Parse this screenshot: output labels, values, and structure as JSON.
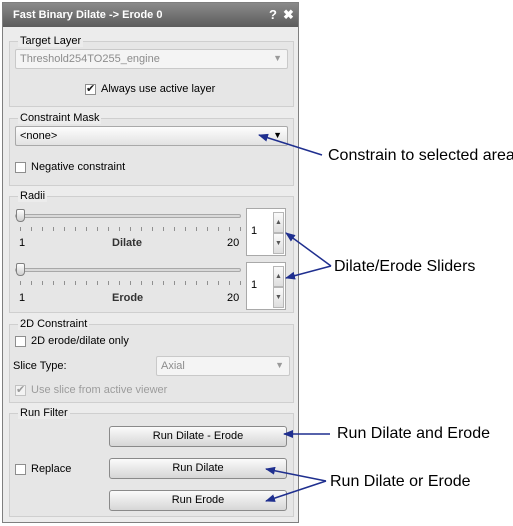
{
  "window": {
    "title": "Fast Binary Dilate -> Erode 0",
    "help_glyph": "?",
    "close_glyph": "✖"
  },
  "target_layer": {
    "group_title": "Target Layer",
    "selected": "Threshold254TO255_engine",
    "always_active_label": "Always use active layer",
    "always_active_checked": true
  },
  "constraint_mask": {
    "group_title": "Constraint Mask",
    "selected": "<none>",
    "negative_label": "Negative constraint",
    "negative_checked": false
  },
  "radii": {
    "group_title": "Radii",
    "sliders": [
      {
        "name": "Dilate",
        "min": "1",
        "max": "20",
        "value": "1"
      },
      {
        "name": "Erode",
        "min": "1",
        "max": "20",
        "value": "1"
      }
    ]
  },
  "constraint_2d": {
    "group_title": "2D Constraint",
    "only_label": "2D erode/dilate only",
    "only_checked": false,
    "slice_type_label": "Slice Type:",
    "slice_type_value": "Axial",
    "use_slice_label": "Use slice from active viewer",
    "use_slice_checked": true
  },
  "run_filter": {
    "group_title": "Run Filter",
    "replace_label": "Replace",
    "replace_checked": false,
    "buttons": [
      "Run Dilate - Erode",
      "Run Dilate",
      "Run Erode"
    ]
  },
  "annotations": {
    "constrain": "Constrain to selected area",
    "sliders": "Dilate/Erode Sliders",
    "run_both": "Run Dilate and Erode",
    "run_either": "Run Dilate or Erode"
  },
  "colors": {
    "arrow": "#1f2f8f",
    "titlebar": "#6e6e6e"
  }
}
